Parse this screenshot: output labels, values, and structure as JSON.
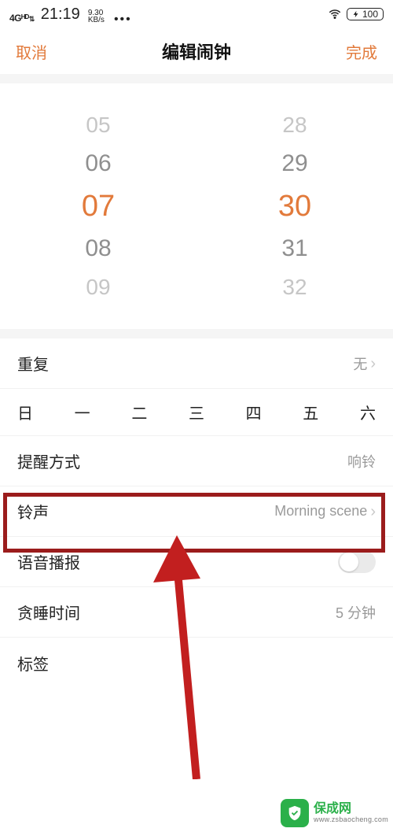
{
  "status": {
    "net_badge": "4Gᴴᴰ",
    "time": "21:19",
    "kbs_top": "9.30",
    "kbs_bot": "KB/s",
    "dots": "•••",
    "battery": "100"
  },
  "nav": {
    "cancel": "取消",
    "title": "编辑闹钟",
    "done": "完成"
  },
  "picker": {
    "hours": [
      "05",
      "06",
      "07",
      "08",
      "09"
    ],
    "minutes": [
      "28",
      "29",
      "30",
      "31",
      "32"
    ],
    "selected_hour_index": 2,
    "selected_minute_index": 2
  },
  "rows": {
    "repeat": {
      "label": "重复",
      "value": "无"
    },
    "weekdays": [
      "日",
      "一",
      "二",
      "三",
      "四",
      "五",
      "六"
    ],
    "remind": {
      "label": "提醒方式",
      "value": "响铃"
    },
    "ringtone": {
      "label": "铃声",
      "value": "Morning scene"
    },
    "voice": {
      "label": "语音播报"
    },
    "snooze": {
      "label": "贪睡时间",
      "value": "5 分钟"
    },
    "tag": {
      "label": "标签"
    }
  },
  "watermark": {
    "name": "保成网",
    "url": "www.zsbaocheng.com"
  }
}
